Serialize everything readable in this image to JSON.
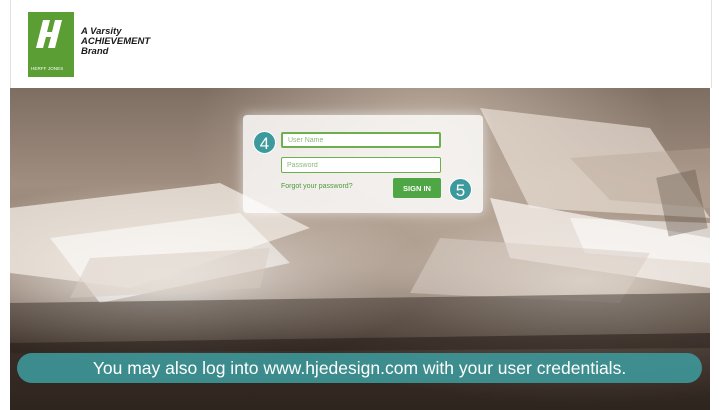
{
  "brand": {
    "logo_wordmark": "HERFF JONES",
    "tagline_line1": "A Varsity",
    "tagline_line2": "ACHIEVEMENT",
    "tagline_line3": "Brand"
  },
  "login": {
    "username_placeholder": "User Name",
    "password_placeholder": "Password",
    "forgot_password_label": "Forgot your password?",
    "sign_in_label": "SIGN IN"
  },
  "annotations": {
    "step_4": "4",
    "step_5": "5",
    "caption": "You may also log into www.hjedesign.com with your user credentials."
  },
  "colors": {
    "brand_green": "#5a9e34",
    "button_green": "#4fa644",
    "annotation_teal": "#3d9a9c"
  }
}
